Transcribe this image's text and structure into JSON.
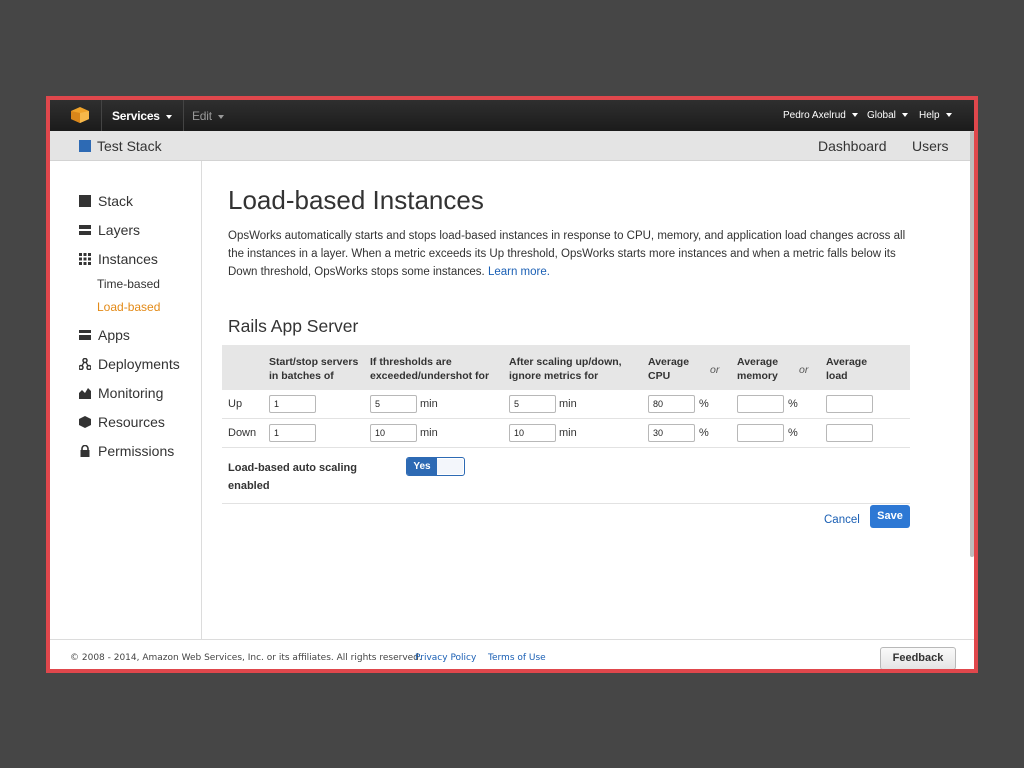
{
  "colors": {
    "frame_border": "#e0474c",
    "accent": "#2d6ab4",
    "active_nav": "#e38a17",
    "link": "#1a5fb4"
  },
  "topbar": {
    "logo_icon": "aws-cube-icon",
    "services": "Services",
    "edit": "Edit",
    "user": "Pedro Axelrud",
    "region": "Global",
    "help": "Help"
  },
  "subbar": {
    "stack_name": "Test Stack",
    "dashboard": "Dashboard",
    "users": "Users"
  },
  "sidebar": {
    "items": [
      {
        "label": "Stack",
        "icon": "stack-icon"
      },
      {
        "label": "Layers",
        "icon": "layers-icon"
      },
      {
        "label": "Instances",
        "icon": "instances-grid-icon"
      },
      {
        "label": "Apps",
        "icon": "apps-icon"
      },
      {
        "label": "Deployments",
        "icon": "deployments-icon"
      },
      {
        "label": "Monitoring",
        "icon": "monitoring-icon"
      },
      {
        "label": "Resources",
        "icon": "resources-icon"
      },
      {
        "label": "Permissions",
        "icon": "lock-icon"
      }
    ],
    "sub_items": [
      {
        "label": "Time-based",
        "active": false
      },
      {
        "label": "Load-based",
        "active": true
      }
    ]
  },
  "page": {
    "title": "Load-based Instances",
    "intro": "OpsWorks automatically starts and stops load-based instances in response to CPU, memory, and application load changes across all the instances in a layer. When a metric exceeds its Up threshold, OpsWorks starts more instances and when a metric falls below its Down threshold, OpsWorks stops some instances. ",
    "learn_more": "Learn more.",
    "section_title": "Rails App Server"
  },
  "table": {
    "headers": {
      "batch": "Start/stop servers in batches of",
      "threshold": "If thresholds are exceeded/undershot for",
      "ignore": "After scaling up/down, ignore metrics for",
      "cpu": "Average CPU",
      "memory": "Average memory",
      "load": "Average load",
      "or": "or"
    },
    "rows": [
      {
        "label": "Up",
        "batch": "1",
        "threshold": "5",
        "ignore": "5",
        "cpu": "80",
        "memory": "",
        "load": ""
      },
      {
        "label": "Down",
        "batch": "1",
        "threshold": "10",
        "ignore": "10",
        "cpu": "30",
        "memory": "",
        "load": ""
      }
    ],
    "unit_min": "min",
    "unit_pct": "%"
  },
  "auto_scaling": {
    "label": "Load-based auto scaling enabled",
    "toggle": "Yes"
  },
  "actions": {
    "cancel": "Cancel",
    "save": "Save"
  },
  "footer": {
    "copyright": "© 2008 - 2014, Amazon Web Services, Inc. or its affiliates. All rights reserved.",
    "privacy": "Privacy Policy",
    "terms": "Terms of Use",
    "feedback": "Feedback"
  }
}
